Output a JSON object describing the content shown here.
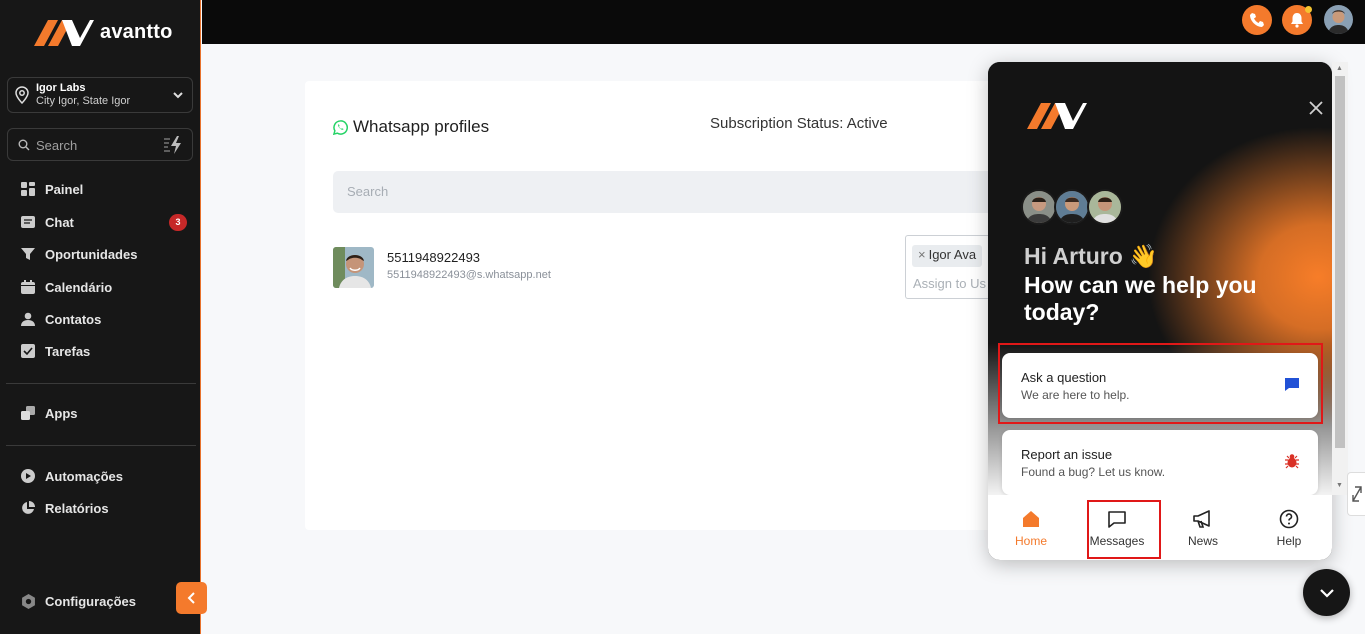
{
  "brand": {
    "name": "avantto",
    "accent": "#f47a2c"
  },
  "location": {
    "name": "Igor Labs",
    "city": "City Igor, State Igor"
  },
  "sidebar_search": {
    "placeholder": "Search"
  },
  "nav": [
    {
      "label": "Painel",
      "icon": "dashboard-icon"
    },
    {
      "label": "Chat",
      "icon": "chat-icon",
      "badge": "3"
    },
    {
      "label": "Oportunidades",
      "icon": "funnel-icon"
    },
    {
      "label": "Calendário",
      "icon": "calendar-icon"
    },
    {
      "label": "Contatos",
      "icon": "person-icon"
    },
    {
      "label": "Tarefas",
      "icon": "checkbox-icon"
    },
    {
      "label": "Apps",
      "icon": "apps-icon"
    },
    {
      "label": "Automações",
      "icon": "automation-icon"
    },
    {
      "label": "Relatórios",
      "icon": "pie-chart-icon"
    },
    {
      "label": "Configurações",
      "icon": "settings-icon"
    }
  ],
  "main": {
    "title": "Whatsapp profiles",
    "subscription_status": "Subscription Status: Active",
    "search_placeholder": "Search",
    "profile": {
      "phone": "5511948922493",
      "jid": "5511948922493@s.whatsapp.net",
      "assigned_chip": "Igor Ava",
      "assign_placeholder": "Assign to Us"
    }
  },
  "widget": {
    "greeting": "Hi Arturo 👋",
    "headline": "How can we help you today?",
    "cards": [
      {
        "title": "Ask a question",
        "subtitle": "We are here to help.",
        "icon": "message-icon"
      },
      {
        "title": "Report an issue",
        "subtitle": "Found a bug? Let us know.",
        "icon": "bug-icon"
      }
    ],
    "tabs": [
      {
        "label": "Home",
        "icon": "home-icon"
      },
      {
        "label": "Messages",
        "icon": "messages-icon"
      },
      {
        "label": "News",
        "icon": "megaphone-icon"
      },
      {
        "label": "Help",
        "icon": "help-icon"
      }
    ]
  }
}
